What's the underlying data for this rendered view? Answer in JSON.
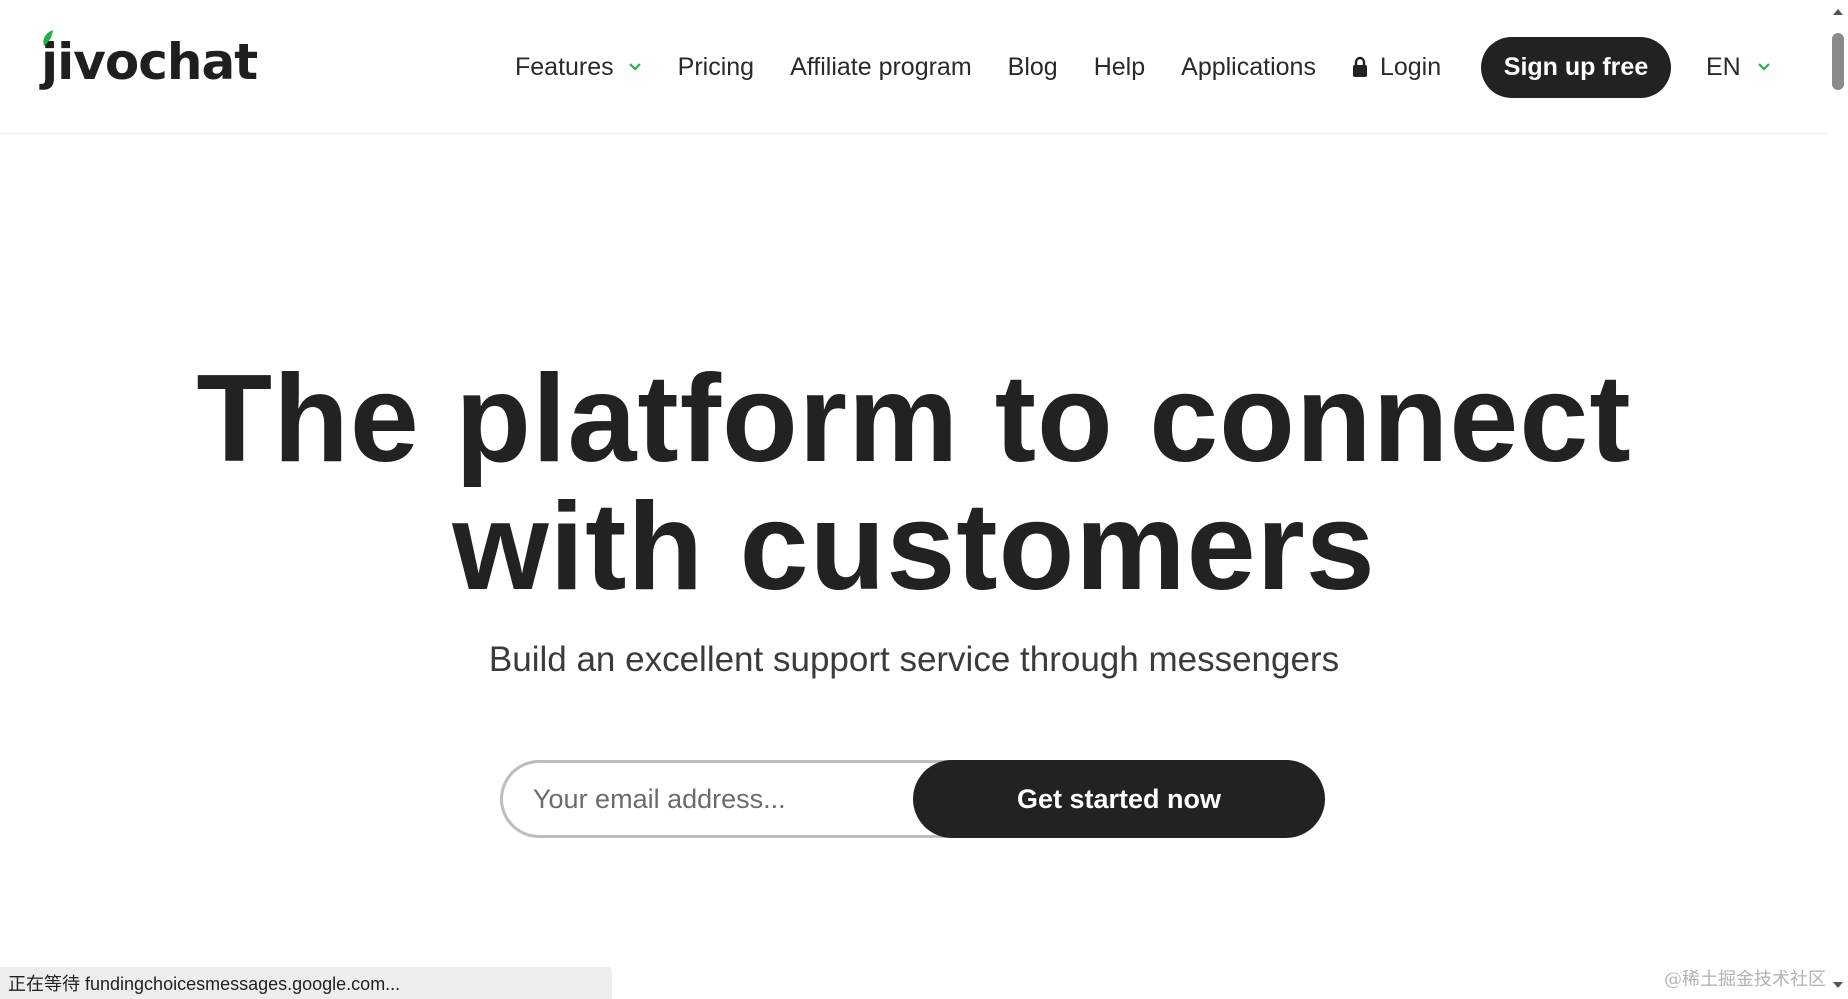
{
  "brand": {
    "name": "jivochat",
    "accent": "#22b24c"
  },
  "nav": {
    "items": [
      {
        "label": "Features",
        "has_dropdown": true
      },
      {
        "label": "Pricing"
      },
      {
        "label": "Affiliate program"
      },
      {
        "label": "Blog"
      },
      {
        "label": "Help"
      },
      {
        "label": "Applications"
      },
      {
        "label": "Login",
        "icon": "lock-icon"
      }
    ],
    "signup_label": "Sign up free",
    "language": "EN"
  },
  "hero": {
    "title_line1": "The platform to connect",
    "title_line2": "with customers",
    "subtitle": "Build an excellent support service through messengers",
    "email_placeholder": "Your email address...",
    "cta_label": "Get started now"
  },
  "statusbar": {
    "text": "正在等待 fundingchoicesmessages.google.com..."
  },
  "watermark": {
    "text": "@稀土掘金技术社区"
  },
  "colors": {
    "dark": "#222222",
    "text": "#2a2a2a",
    "chevron": "#22b24c"
  }
}
